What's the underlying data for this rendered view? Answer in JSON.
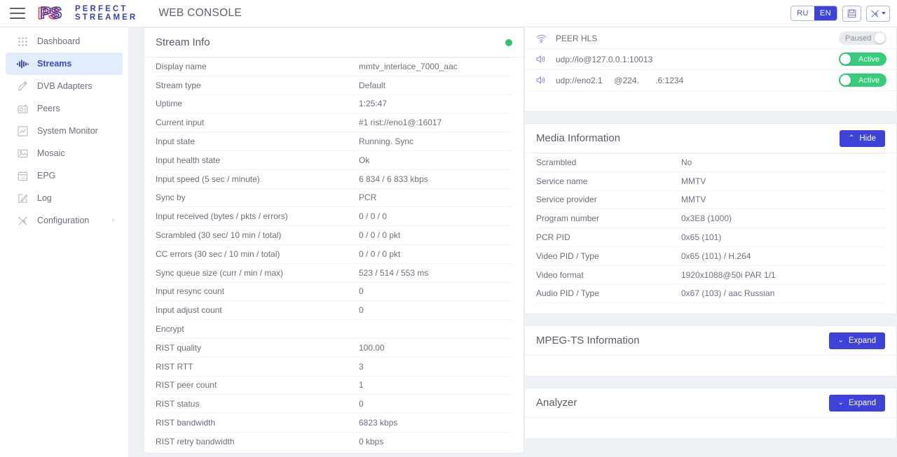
{
  "header": {
    "menu_icon": "hamburger-icon",
    "brand_line1": "PERFECT",
    "brand_line2": "STREAMER",
    "console_title": "WEB CONSOLE",
    "lang_ru": "RU",
    "lang_en": "EN",
    "save_icon": "save-icon",
    "tools_icon": "tools-icon"
  },
  "sidebar": {
    "items": [
      {
        "label": "Dashboard",
        "icon": "grid-dots-icon",
        "active": false
      },
      {
        "label": "Streams",
        "icon": "waveform-icon",
        "active": true
      },
      {
        "label": "DVB Adapters",
        "icon": "satellite-dish-icon",
        "active": false
      },
      {
        "label": "Peers",
        "icon": "radio-icon",
        "active": false
      },
      {
        "label": "System Monitor",
        "icon": "chart-line-icon",
        "active": false
      },
      {
        "label": "Mosaic",
        "icon": "image-icon",
        "active": false
      },
      {
        "label": "EPG",
        "icon": "calendar-icon",
        "active": false
      },
      {
        "label": "Log",
        "icon": "pencil-square-icon",
        "active": false
      },
      {
        "label": "Configuration",
        "icon": "tools-icon",
        "active": false,
        "chevron": "›"
      }
    ]
  },
  "stream_info": {
    "title": "Stream Info",
    "status_dot_color": "#2fc26e",
    "rows": [
      {
        "key": "Display name",
        "value": "mmtv_interlace_7000_aac"
      },
      {
        "key": "Stream type",
        "value": "Default"
      },
      {
        "key": "Uptime",
        "value": "1:25:47"
      },
      {
        "key": "Current input",
        "value": "#1 rist://eno1@:16017"
      },
      {
        "key": "Input state",
        "value": "Running. Sync"
      },
      {
        "key": "Input health state",
        "value": "Ok"
      },
      {
        "key": "Input speed (5 sec / minute)",
        "value": "6 834 / 6 833 kbps"
      },
      {
        "key": "Sync by",
        "value": "PCR"
      },
      {
        "key": "Input received (bytes / pkts / errors)",
        "value": "0 / 0 / 0"
      },
      {
        "key": "Scrambled (30 sec/ 10 min / total)",
        "value": "0 / 0 / 0 pkt"
      },
      {
        "key": "CC errors (30 sec / 10 min / total)",
        "value": "0 / 0 / 0 pkt"
      },
      {
        "key": "Sync queue size (curr / min / max)",
        "value": "523 / 514 / 553 ms"
      },
      {
        "key": "Input resync count",
        "value": "0"
      },
      {
        "key": "Input adjust count",
        "value": "0"
      },
      {
        "key": "Encrypt",
        "value": ""
      },
      {
        "key": "RIST quality",
        "value": "100.00"
      },
      {
        "key": "RIST RTT",
        "value": "3"
      },
      {
        "key": "RIST peer count",
        "value": "1"
      },
      {
        "key": "RIST status",
        "value": "0"
      },
      {
        "key": "RIST bandwidth",
        "value": "6823 kbps"
      },
      {
        "key": "RIST retry bandwidth",
        "value": "0 kbps"
      }
    ]
  },
  "outputs": {
    "rows": [
      {
        "icon": "wifi-icon",
        "label": "PEER HLS",
        "state": "Paused",
        "active": false
      },
      {
        "icon": "speaker-icon",
        "label": "udp://lo@127.0.0.1:10013",
        "state": "Active",
        "active": true
      },
      {
        "icon": "speaker-icon",
        "label": "udp://eno2.1     @224.       .6:1234",
        "state": "Active",
        "active": true
      }
    ]
  },
  "media_information": {
    "title": "Media Information",
    "toggle_label": "Hide",
    "toggle_chevron": "⌃",
    "rows": [
      {
        "key": "Scrambled",
        "value": "No"
      },
      {
        "key": "Service name",
        "value": "MMTV"
      },
      {
        "key": "Service provider",
        "value": "MMTV"
      },
      {
        "key": "Program number",
        "value": "0x3E8 (1000)"
      },
      {
        "key": "PCR PID",
        "value": "0x65 (101)"
      },
      {
        "key": "Video PID / Type",
        "value": "0x65 (101) / H.264"
      },
      {
        "key": "Video format",
        "value": "1920x1088@50i PAR 1/1"
      },
      {
        "key": "Audio PID / Type",
        "value": "0x67 (103) / aac Russian"
      }
    ]
  },
  "mpegts_information": {
    "title": "MPEG-TS Information",
    "toggle_label": "Expand",
    "toggle_chevron": "⌄"
  },
  "analyzer": {
    "title": "Analyzer",
    "toggle_label": "Expand",
    "toggle_chevron": "⌄"
  }
}
